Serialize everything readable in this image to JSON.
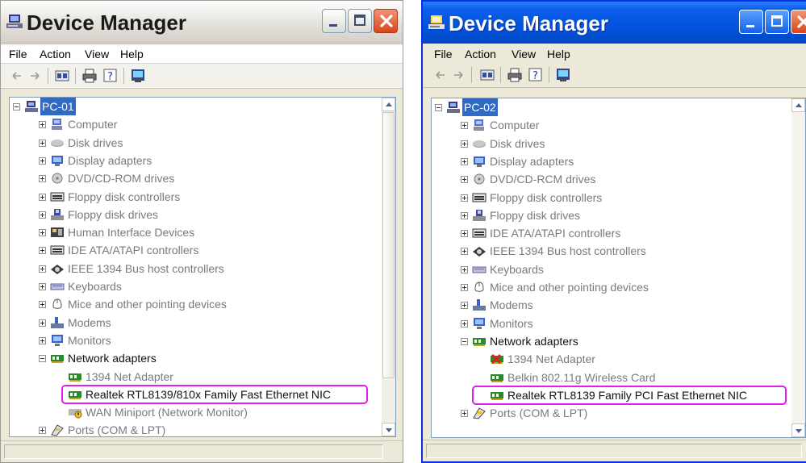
{
  "colors": {
    "xp_blue_title": "#0453dc",
    "selection": "#316ac5",
    "highlight_ring": "#e020e8",
    "window_face": "#ece9d8"
  },
  "windows": [
    {
      "title": "Device Manager",
      "theme": "classic-silver",
      "menu": [
        "File",
        "Action",
        "View",
        "Help"
      ],
      "root": "PC-01",
      "categories": [
        {
          "label": "Computer",
          "icon": "computer-icon"
        },
        {
          "label": "Disk drives",
          "icon": "disk-drive-icon"
        },
        {
          "label": "Display adapters",
          "icon": "display-adapter-icon"
        },
        {
          "label": "DVD/CD-ROM drives",
          "icon": "dvd-drive-icon"
        },
        {
          "label": "Floppy disk controllers",
          "icon": "controller-icon"
        },
        {
          "label": "Floppy disk drives",
          "icon": "floppy-drive-icon"
        },
        {
          "label": "Human Interface Devices",
          "icon": "hid-icon"
        },
        {
          "label": "IDE ATA/ATAPI controllers",
          "icon": "controller-icon"
        },
        {
          "label": "IEEE 1394 Bus host controllers",
          "icon": "ieee1394-icon"
        },
        {
          "label": "Keyboards",
          "icon": "keyboard-icon"
        },
        {
          "label": "Mice and other pointing devices",
          "icon": "mouse-icon"
        },
        {
          "label": "Modems",
          "icon": "modem-icon"
        },
        {
          "label": "Monitors",
          "icon": "monitor-icon"
        },
        {
          "label": "Network adapters",
          "icon": "network-adapter-icon",
          "expanded": true
        },
        {
          "label": "Ports (COM & LPT)",
          "icon": "port-icon"
        }
      ],
      "network_children": [
        {
          "label": "1394 Net Adapter",
          "icon": "network-card-icon"
        },
        {
          "label": "Realtek RTL8139/810x Family Fast Ethernet NIC",
          "icon": "network-card-icon",
          "highlighted": true
        },
        {
          "label": "WAN Miniport (Network Monitor)",
          "icon": "warning-network-icon"
        }
      ]
    },
    {
      "title": "Device Manager",
      "theme": "luna-blue",
      "menu": [
        "File",
        "Action",
        "View",
        "Help"
      ],
      "root": "PC-02",
      "categories": [
        {
          "label": "Computer",
          "icon": "computer-icon"
        },
        {
          "label": "Disk drives",
          "icon": "disk-drive-icon"
        },
        {
          "label": "Display adapters",
          "icon": "display-adapter-icon"
        },
        {
          "label": "DVD/CD-RCM drives",
          "icon": "dvd-drive-icon"
        },
        {
          "label": "Floppy disk controllers",
          "icon": "controller-icon"
        },
        {
          "label": "Floppy disk drives",
          "icon": "floppy-drive-icon"
        },
        {
          "label": "IDE ATA/ATAPI controllers",
          "icon": "controller-icon"
        },
        {
          "label": "IEEE 1394 Bus host controllers",
          "icon": "ieee1394-icon"
        },
        {
          "label": "Keyboards",
          "icon": "keyboard-icon"
        },
        {
          "label": "Mice and other pointing devices",
          "icon": "mouse-icon"
        },
        {
          "label": "Modems",
          "icon": "modem-icon"
        },
        {
          "label": "Monitors",
          "icon": "monitor-icon"
        },
        {
          "label": "Network adapters",
          "icon": "network-adapter-icon",
          "expanded": true
        }
      ],
      "network_children": [
        {
          "label": "1394 Net Adapter",
          "icon": "disabled-network-card-icon"
        },
        {
          "label": "Belkin 802.11g Wireless Card",
          "icon": "network-card-icon"
        },
        {
          "label": "Realtek RTL8139 Family PCI Fast Ethernet NIC",
          "icon": "network-card-icon",
          "highlighted": true
        }
      ],
      "after_network": [
        {
          "label": "Ports (COM & LPT)",
          "icon": "port-icon"
        }
      ]
    }
  ]
}
